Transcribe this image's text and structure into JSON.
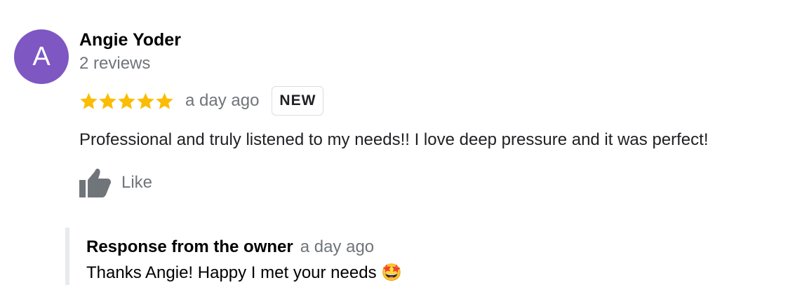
{
  "review": {
    "author": {
      "initial": "A",
      "name": "Angie Yoder",
      "review_count": "2 reviews",
      "avatar_color": "#7e57c2"
    },
    "rating": 5,
    "star_color": "#fbbc04",
    "date": "a day ago",
    "badge": "NEW",
    "text": "Professional and truly listened to my needs!! I love deep pressure and it was perfect!",
    "like_label": "Like",
    "like_icon": "thumbs-up-icon",
    "owner_response": {
      "title": "Response from the owner",
      "date": "a day ago",
      "text": "Thanks Angie! Happy I met your needs 🤩"
    }
  }
}
